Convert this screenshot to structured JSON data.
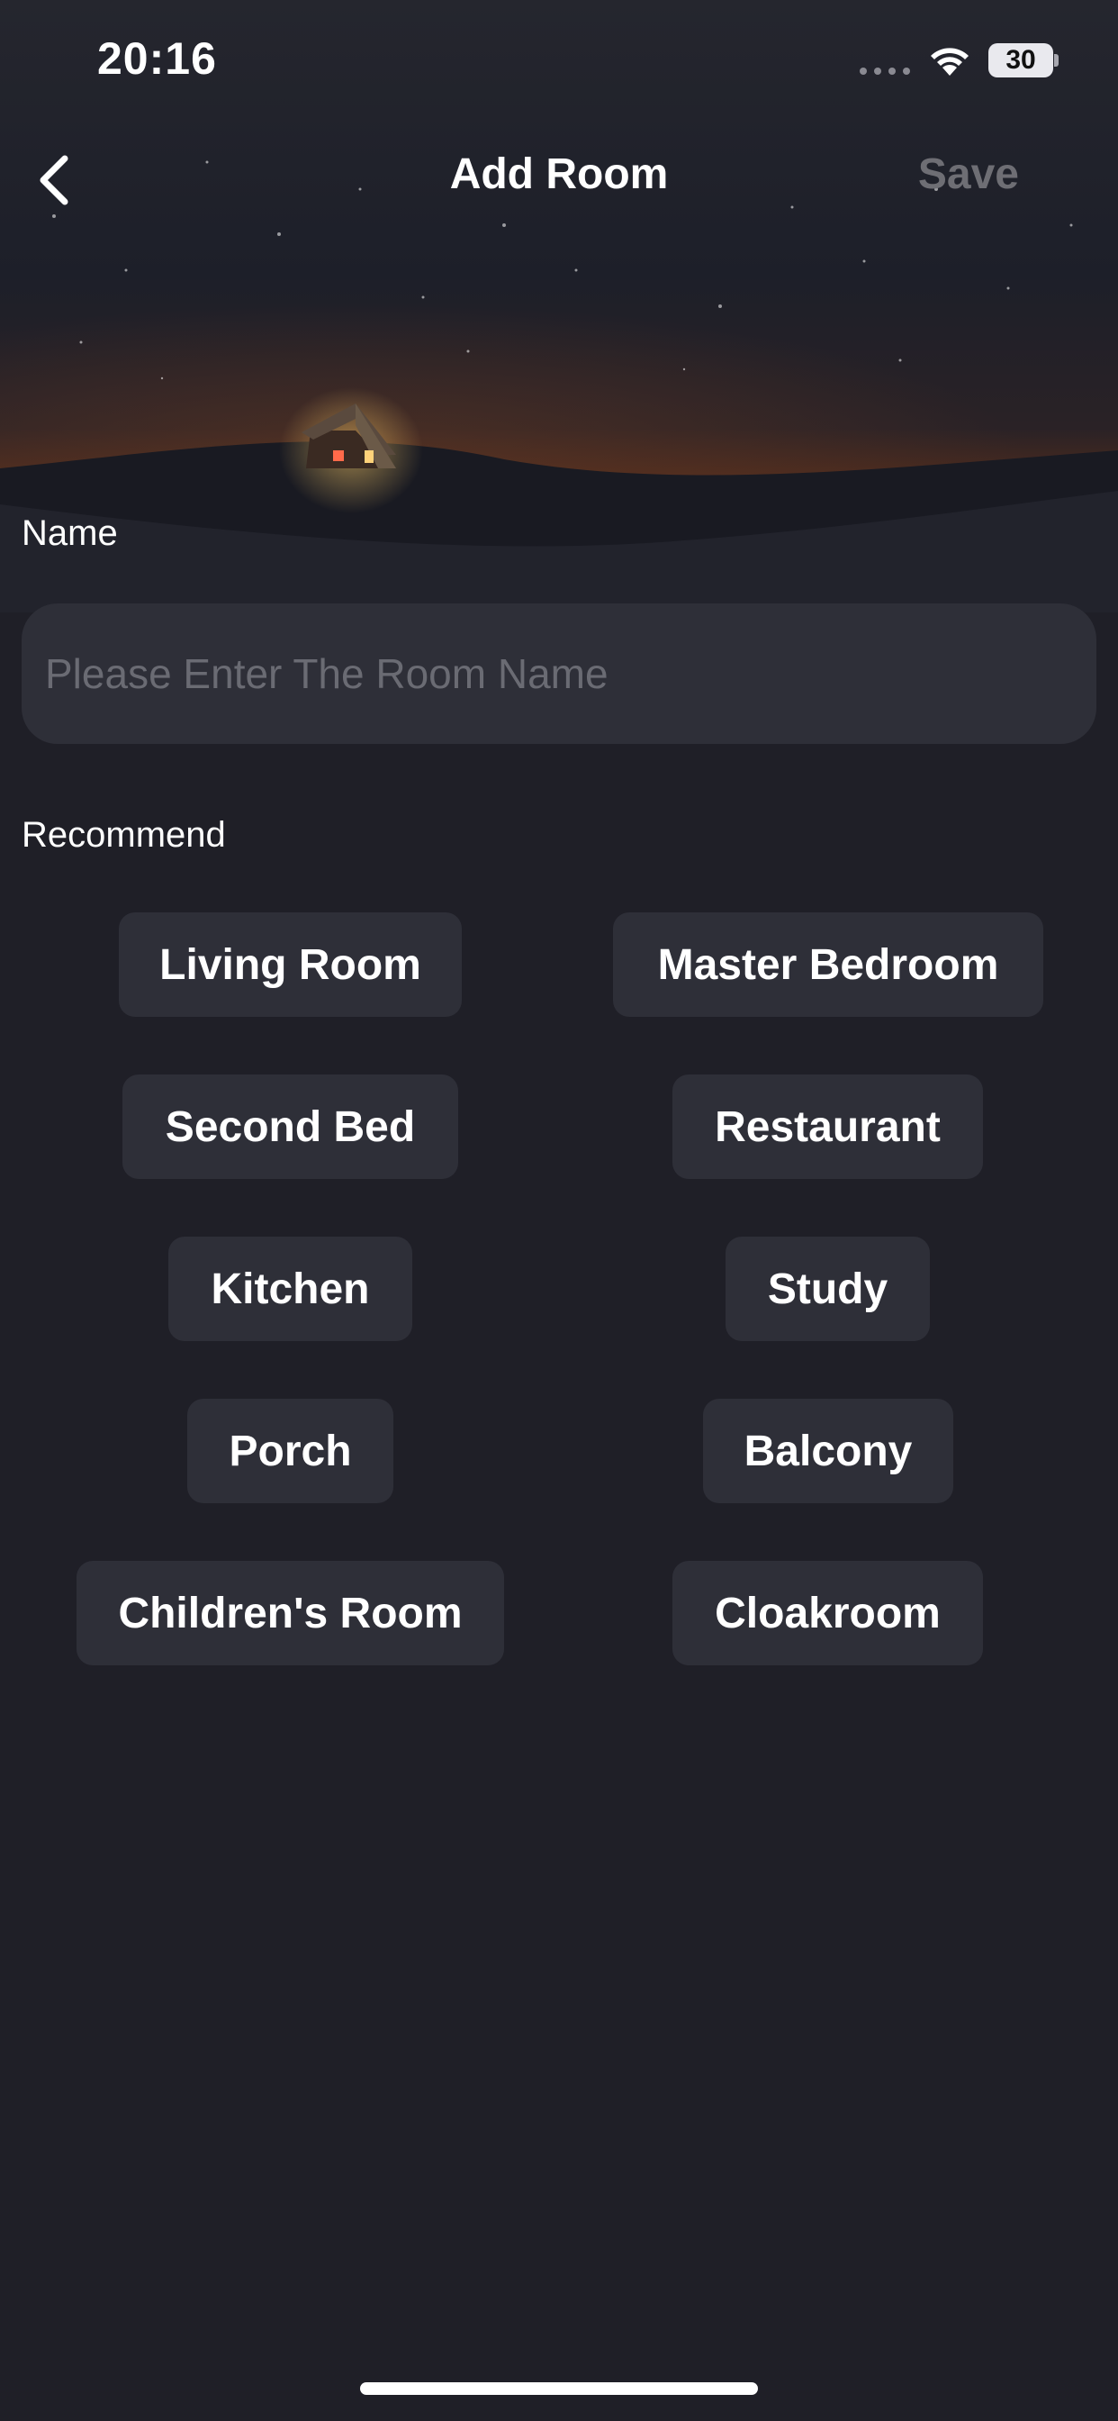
{
  "status_bar": {
    "time": "20:16",
    "battery": "30"
  },
  "nav": {
    "title": "Add Room",
    "save_label": "Save"
  },
  "form": {
    "name_label": "Name",
    "name_placeholder": "Please Enter The Room Name",
    "name_value": ""
  },
  "recommend": {
    "label": "Recommend",
    "items": [
      "Living Room",
      "Master Bedroom",
      "Second Bed",
      "Restaurant",
      "Kitchen",
      "Study",
      "Porch",
      "Balcony",
      "Children's Room",
      "Cloakroom"
    ]
  }
}
